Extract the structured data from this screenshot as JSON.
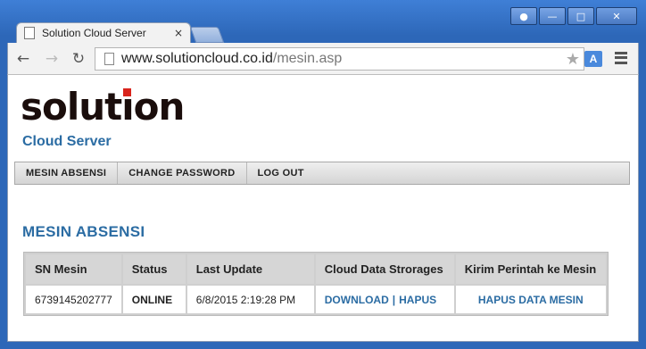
{
  "browser": {
    "tab_title": "Solution Cloud Server",
    "tab_close": "×",
    "url_host": "www.solutioncloud.co.id",
    "url_path": "/mesin.asp",
    "icons": {
      "back": "back-arrow-icon",
      "forward": "forward-arrow-icon",
      "reload": "reload-icon",
      "star": "bookmark-star-icon",
      "translate": "translate-icon",
      "menu": "hamburger-menu-icon"
    },
    "window_controls": [
      "user",
      "minimize",
      "maximize",
      "close"
    ]
  },
  "brand": {
    "logo_text": "solution",
    "subtitle": "Cloud Server",
    "accent_color": "#2b6ca3",
    "logo_dot_color": "#d9241c"
  },
  "nav": {
    "items": [
      "MESIN ABSENSI",
      "CHANGE PASSWORD",
      "LOG OUT"
    ]
  },
  "page": {
    "title": "MESIN ABSENSI"
  },
  "table": {
    "headers": [
      "SN Mesin",
      "Status",
      "Last Update",
      "Cloud Data Strorages",
      "Kirim Perintah ke Mesin"
    ],
    "rows": [
      {
        "sn": "6739145202777",
        "status": "ONLINE",
        "last_update": "6/8/2015 2:19:28 PM",
        "download": "DOWNLOAD",
        "separator": "|",
        "hapus": "HAPUS",
        "command": "HAPUS DATA MESIN"
      }
    ],
    "status_color": "#2a7d1e"
  }
}
